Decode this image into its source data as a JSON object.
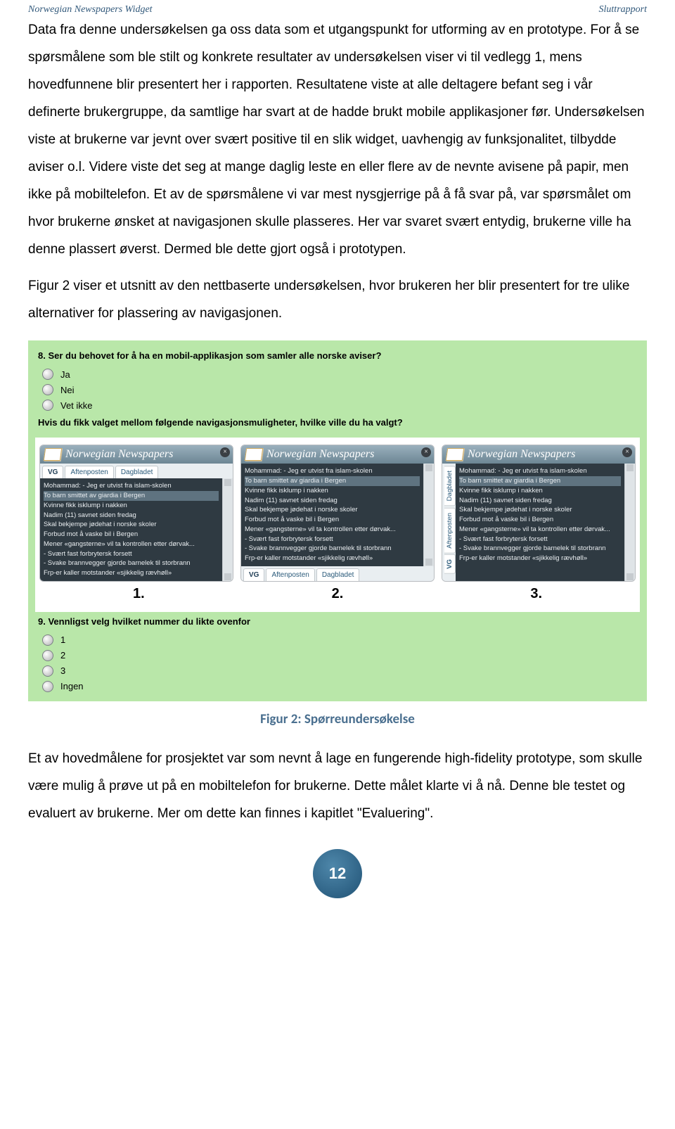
{
  "header": {
    "left": "Norwegian Newspapers Widget",
    "right": "Sluttrapport"
  },
  "para1": "Data fra denne undersøkelsen ga oss data som et utgangspunkt for utforming av en prototype. For å se spørsmålene som ble stilt og konkrete resultater av undersøkelsen viser vi til vedlegg 1, mens hovedfunnene blir presentert her i rapporten. Resultatene viste at alle deltagere befant seg i vår definerte brukergruppe, da samtlige har svart at de hadde brukt mobile applikasjoner før. Undersøkelsen viste at brukerne var jevnt over svært positive til en slik widget, uavhengig av funksjonalitet, tilbydde aviser o.l. Videre viste det seg at mange daglig leste en eller flere av de nevnte avisene på papir, men ikke på mobiltelefon. Et av de spørsmålene vi var mest nysgjerrige på å få svar på, var spørsmålet om hvor brukerne ønsket at navigasjonen skulle plasseres. Her var svaret svært entydig, brukerne ville ha denne plassert øverst. Dermed ble dette gjort også i prototypen.",
  "para2": "Figur 2 viser et utsnitt av den nettbaserte undersøkelsen, hvor brukeren her blir presentert for tre ulike alternativer for plassering av navigasjonen.",
  "survey": {
    "q8": "8. Ser du behovet for å ha en mobil-applikasjon som samler alle norske aviser?",
    "q8_opts": [
      "Ja",
      "Nei",
      "Vet ikke"
    ],
    "q_mid": "Hvis du fikk valget mellom følgende navigasjonsmuligheter, hvilke ville du ha valgt?",
    "q9": "9. Vennligst velg hvilket nummer du likte ovenfor",
    "q9_opts": [
      "1",
      "2",
      "3",
      "Ingen"
    ],
    "nums": [
      "1.",
      "2.",
      "3."
    ]
  },
  "mock": {
    "title": "Norwegian Newspapers",
    "close": "×",
    "tabs": [
      "VG",
      "Aftenposten",
      "Dagbladet"
    ],
    "headlines": [
      "Mohammad: - Jeg er utvist fra islam-skolen",
      "To barn smittet av giardia i Bergen",
      "Kvinne fikk isklump i nakken",
      "Nadim (11) savnet siden fredag",
      "Skal bekjempe jødehat i norske skoler",
      "Forbud mot å vaske bil i Bergen",
      "Mener «gangsterne» vil ta kontrollen etter dørvak...",
      "- Svært fast forbrytersk forsett",
      "- Svake brannvegger gjorde barnelek til storbrann",
      "Frp-er kaller motstander «sjikkelig rævhøll»"
    ]
  },
  "caption": "Figur 2: Spørreundersøkelse",
  "para3": "Et av hovedmålene for prosjektet var som nevnt å lage en fungerende high-fidelity prototype, som skulle være mulig å prøve ut på en mobiltelefon for brukerne. Dette målet klarte vi å nå. Denne ble testet og evaluert av brukerne. Mer om dette kan finnes i kapitlet \"Evaluering\".",
  "page_number": "12"
}
